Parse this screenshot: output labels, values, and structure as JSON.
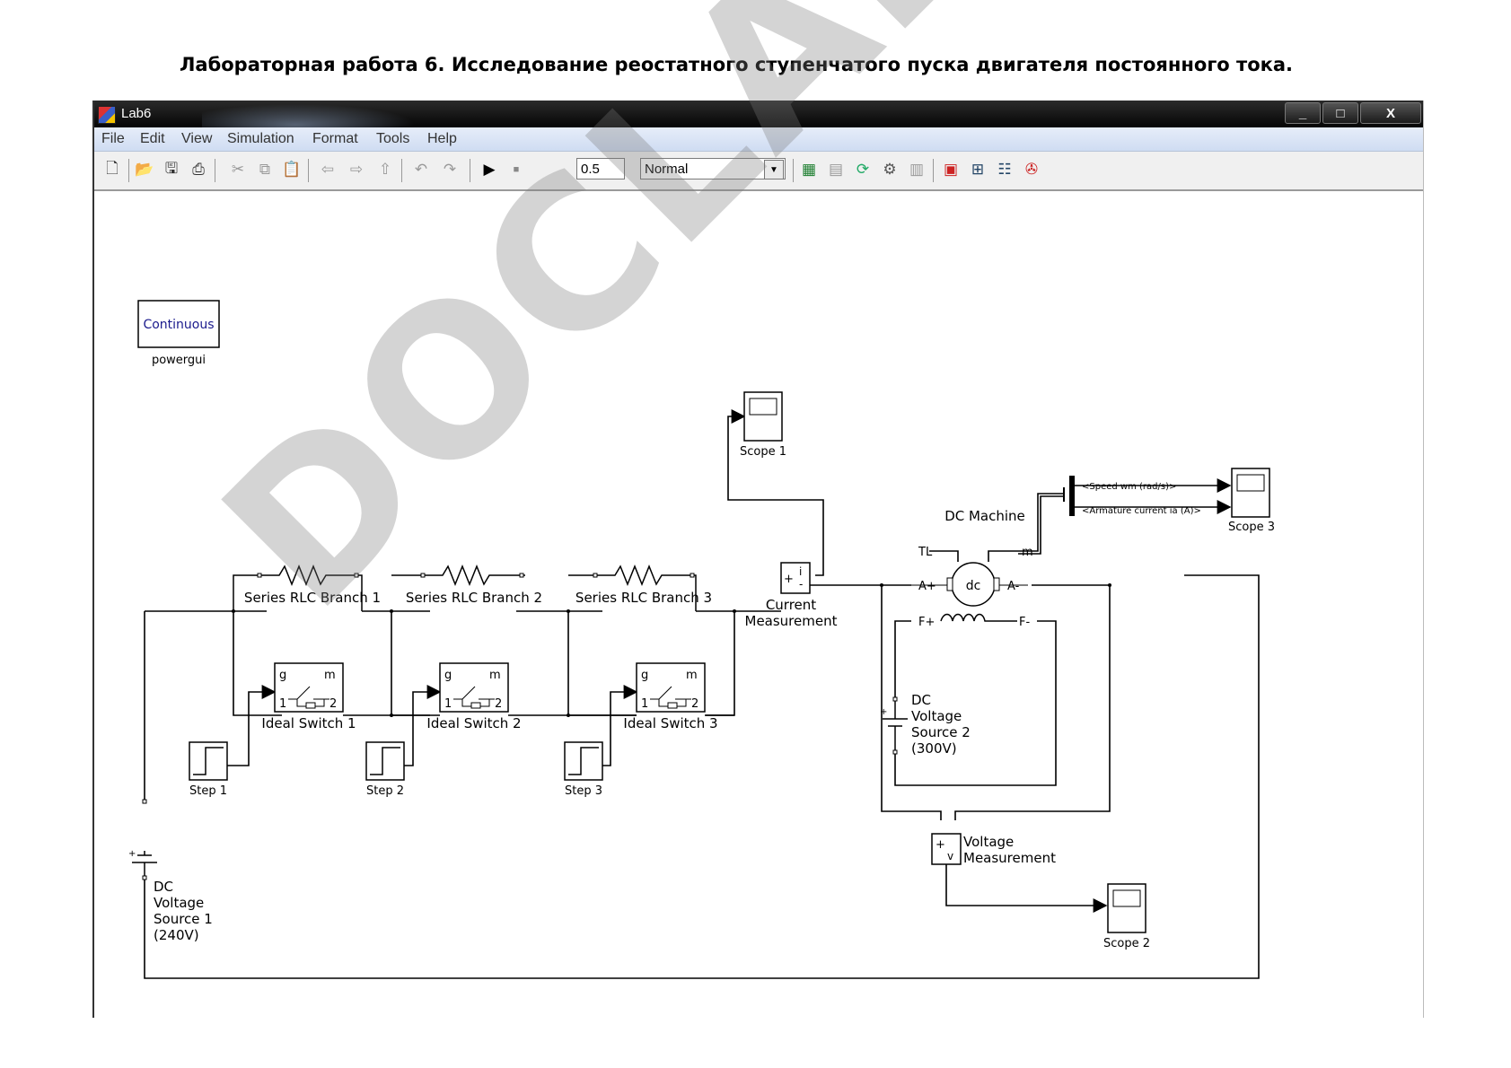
{
  "document": {
    "title": "Лабораторная работа 6. Исследование реостатного ступенчатого пуска двигателя постоянного тока."
  },
  "window": {
    "title": "Lab6",
    "controls": {
      "minimize": "_",
      "restore": "□",
      "close": "X"
    }
  },
  "menu": [
    "File",
    "Edit",
    "View",
    "Simulation",
    "Format",
    "Tools",
    "Help"
  ],
  "toolbar": {
    "stop_time": "0.5",
    "sim_mode": "Normal",
    "icons": [
      "new-icon",
      "open-icon",
      "save-icon",
      "print-icon",
      "cut-icon",
      "copy-icon",
      "paste-icon",
      "back-icon",
      "forward-icon",
      "up-icon",
      "undo-icon",
      "redo-icon",
      "start-icon",
      "stop-icon",
      "library-icon",
      "model-explorer-icon",
      "update-icon",
      "build-icon",
      "debug-icon",
      "blocks-icon",
      "explorer-icon",
      "properties-icon",
      "advisor-icon"
    ]
  },
  "blocks": {
    "powergui": {
      "text": "Continuous",
      "label": "powergui"
    },
    "rlc1": "Series RLC Branch 1",
    "rlc2": "Series RLC Branch 2",
    "rlc3": "Series RLC Branch 3",
    "sw1": "Ideal Switch 1",
    "sw2": "Ideal Switch 2",
    "sw3": "Ideal Switch 3",
    "step1": "Step 1",
    "step2": "Step 2",
    "step3": "Step 3",
    "scope1": "Scope 1",
    "scope2": "Scope 2",
    "scope3": "Scope 3",
    "current_meas": [
      "Current",
      "Measurement"
    ],
    "voltage_meas": [
      "Voltage",
      "Measurement"
    ],
    "dc_machine": "DC Machine",
    "dc_src1": [
      "DC",
      "Voltage",
      "Source 1",
      "(240V)"
    ],
    "dc_src2": [
      "DC",
      "Voltage",
      "Source 2",
      "(300V)"
    ],
    "bus_speed": "<Speed wm (rad/s)>",
    "bus_current": "<Armature current ia (A)>",
    "port_labels": {
      "g": "g",
      "m": "m",
      "p1": "1",
      "p2": "2",
      "tl": "TL",
      "m_out": "m",
      "a_plus": "A+",
      "a_minus": "A-",
      "f_plus": "F+",
      "f_minus": "F-",
      "dc": "dc",
      "plus": "+",
      "minus": "-",
      "i": "i",
      "v": "v"
    }
  },
  "watermark": "DOCLAB.UZ"
}
